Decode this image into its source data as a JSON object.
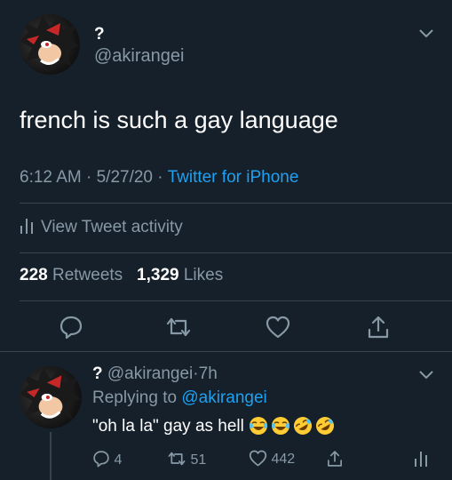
{
  "tweet": {
    "display_name": "?",
    "handle": "@akirangei",
    "text": "french is such a gay language",
    "time": "6:12 AM",
    "sep1": "·",
    "date": "5/27/20",
    "sep2": "·",
    "source": "Twitter for iPhone",
    "activity_label": "View Tweet activity",
    "retweets_count": "228",
    "retweets_label": "Retweets",
    "likes_count": "1,329",
    "likes_label": "Likes"
  },
  "reply": {
    "display_name": "?",
    "handle": "@akirangei",
    "sep": "·",
    "age": "7h",
    "replying_prefix": "Replying to",
    "replying_handle": "@akirangei",
    "text": "\"oh la la\" gay as hell",
    "emojis": [
      "crying-laughing",
      "crying-laughing",
      "rofl",
      "rofl"
    ],
    "reply_count": "4",
    "retweet_count": "51",
    "like_count": "442"
  },
  "colors": {
    "background": "#15202b",
    "accent": "#1da1f2",
    "muted": "#8899a6",
    "divider": "#38444d"
  }
}
